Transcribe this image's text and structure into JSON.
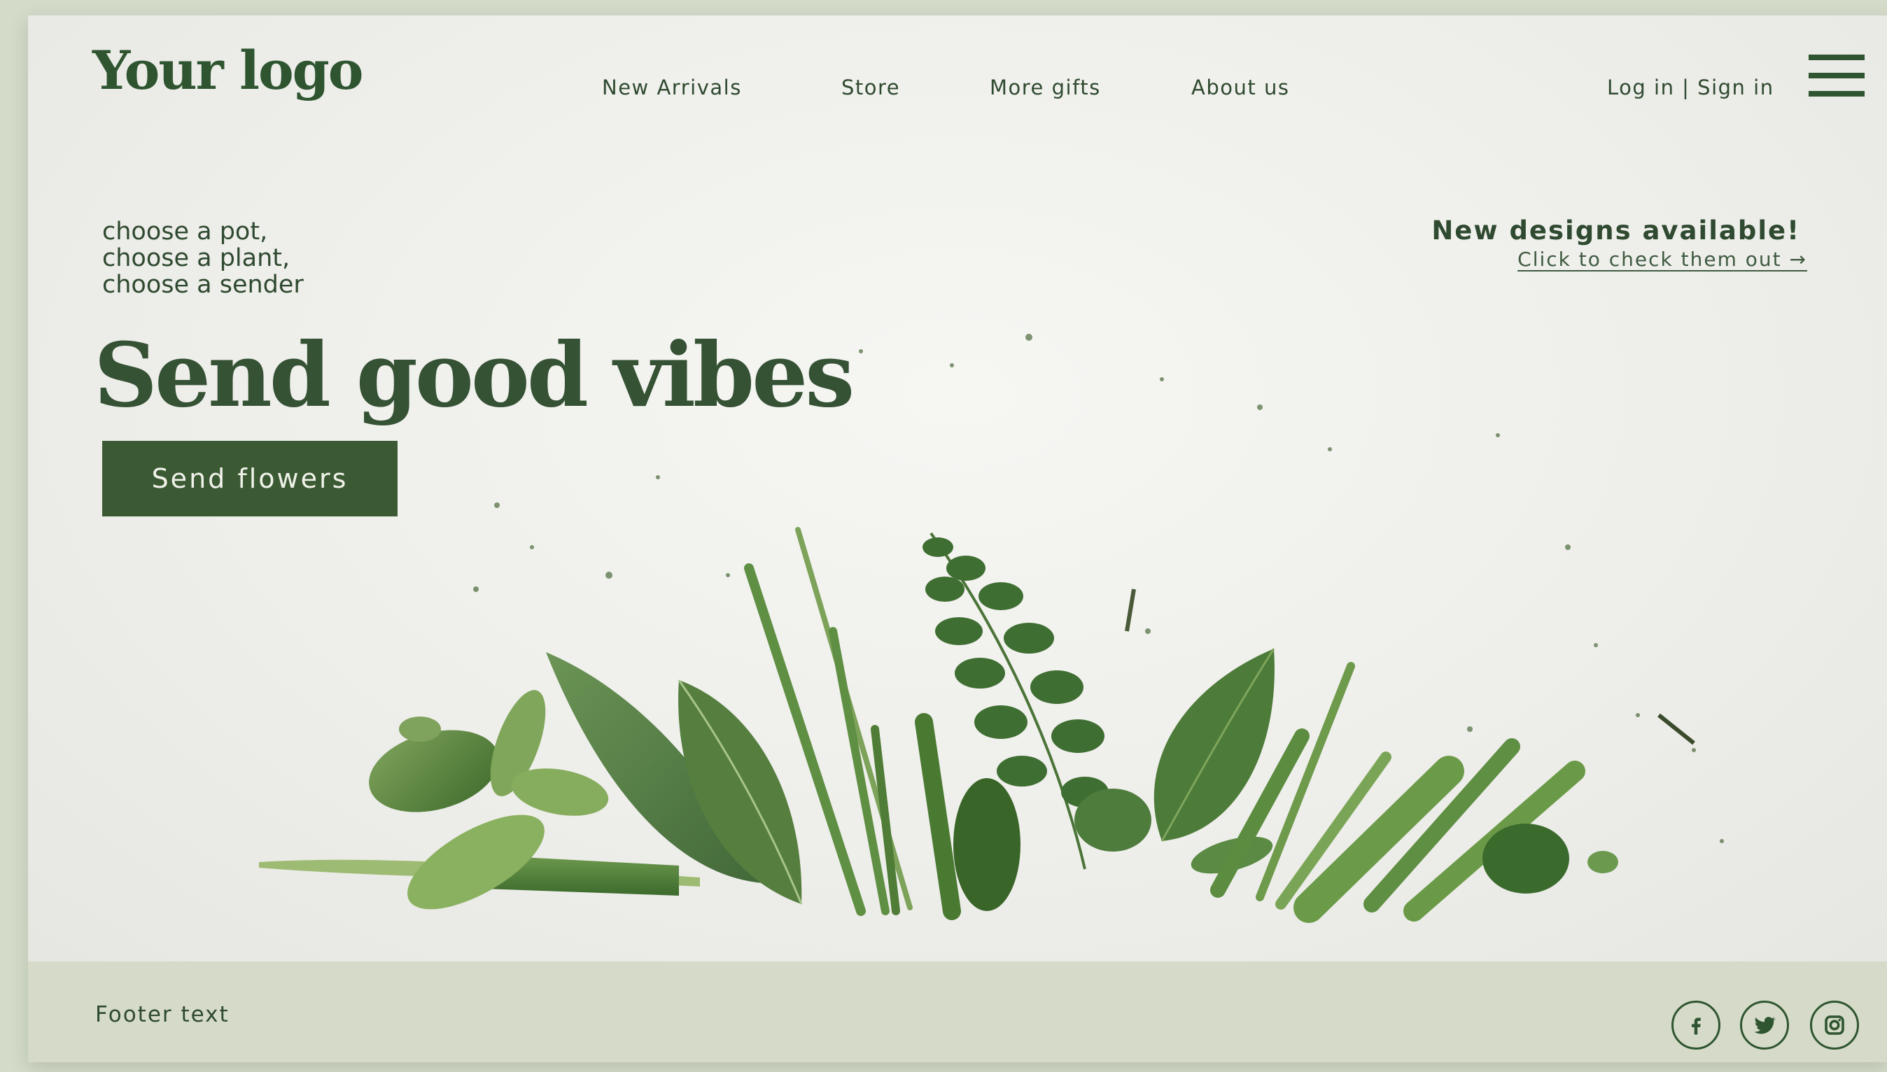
{
  "header": {
    "logo": "Your logo",
    "nav": [
      "New Arrivals",
      "Store",
      "More gifts",
      "About us"
    ],
    "login": "Log in",
    "separator": " | ",
    "signin": "Sign in"
  },
  "hero": {
    "tagline": [
      "choose a pot,",
      "choose a plant,",
      "choose a sender"
    ],
    "headline": "Send good vibes",
    "cta_label": "Send flowers",
    "promo_title": "New designs available!",
    "promo_link": "Click to check them out →"
  },
  "footer": {
    "text": "Footer text",
    "social": [
      "facebook-icon",
      "twitter-icon",
      "instagram-icon"
    ]
  },
  "colors": {
    "brand_green": "#2f5530",
    "button_green": "#3b5a33",
    "background": "#eeeeea",
    "footer": "#d5dbc8"
  }
}
